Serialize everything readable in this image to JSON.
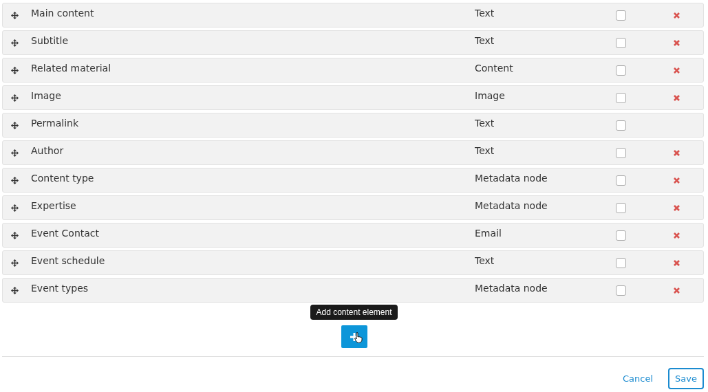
{
  "rows": [
    {
      "name": "Main content",
      "type": "Text",
      "checked": false,
      "removable": true
    },
    {
      "name": "Subtitle",
      "type": "Text",
      "checked": false,
      "removable": true
    },
    {
      "name": "Related material",
      "type": "Content",
      "checked": false,
      "removable": true
    },
    {
      "name": "Image",
      "type": "Image",
      "checked": false,
      "removable": true
    },
    {
      "name": "Permalink",
      "type": "Text",
      "checked": false,
      "removable": false
    },
    {
      "name": "Author",
      "type": "Text",
      "checked": false,
      "removable": true
    },
    {
      "name": "Content type",
      "type": "Metadata node",
      "checked": false,
      "removable": true
    },
    {
      "name": "Expertise",
      "type": "Metadata node",
      "checked": false,
      "removable": true
    },
    {
      "name": "Event Contact",
      "type": "Email",
      "checked": false,
      "removable": true
    },
    {
      "name": "Event schedule",
      "type": "Text",
      "checked": false,
      "removable": true
    },
    {
      "name": "Event types",
      "type": "Metadata node",
      "checked": false,
      "removable": true
    }
  ],
  "add_tooltip": "Add content element",
  "actions": {
    "cancel": "Cancel",
    "save": "Save"
  }
}
